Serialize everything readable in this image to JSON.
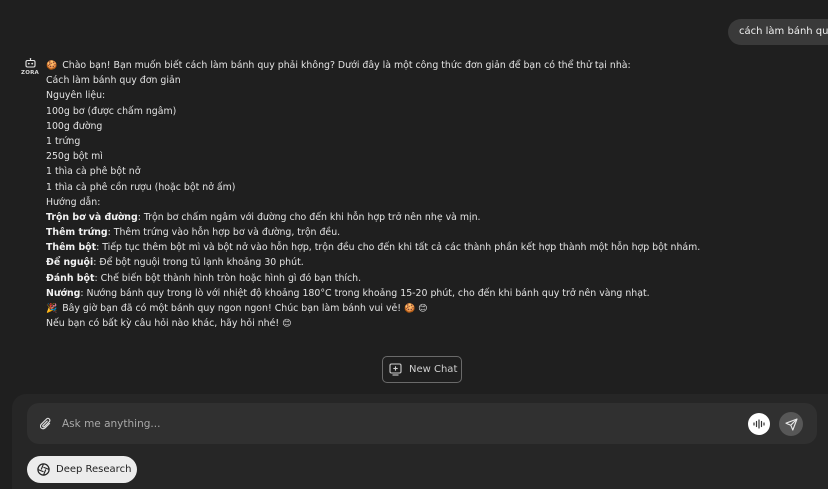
{
  "user_message": "cách làm bánh quy",
  "bot": {
    "name": "ZORA"
  },
  "answer": {
    "intro_emoji": "🍪",
    "intro": "Chào bạn! Bạn muốn biết cách làm bánh quy phải không? Dưới đây là một công thức đơn giản để bạn có thể thử tại nhà:",
    "recipe_title": "Cách làm bánh quy đơn giản",
    "ingredients_heading": "Nguyên liệu:",
    "ingredients": [
      "100g bơ (được chấm ngâm)",
      "100g đường",
      "1 trứng",
      "250g bột mì",
      "1 thìa cà phê bột nở",
      "1 thìa cà phê cồn rượu (hoặc bột nở ấm)"
    ],
    "steps_heading": "Hướng dẫn:",
    "steps": [
      {
        "label": "Trộn bơ và đường",
        "text": ": Trộn bơ chấm ngâm với đường cho đến khi hỗn hợp trở nên nhẹ và mịn."
      },
      {
        "label": "Thêm trứng",
        "text": ": Thêm trứng vào hỗn hợp bơ và đường, trộn đều."
      },
      {
        "label": "Thêm bột",
        "text": ": Tiếp tục thêm bột mì và bột nở vào hỗn hợp, trộn đều cho đến khi tất cả các thành phần kết hợp thành một hỗn hợp bột nhám."
      },
      {
        "label": "Để nguội",
        "text": ": Để bột nguội trong tủ lạnh khoảng 30 phút."
      },
      {
        "label": "Đánh bột",
        "text": ": Chế biến bột thành hình tròn hoặc hình gì đó bạn thích."
      },
      {
        "label": "Nướng",
        "text": ": Nướng bánh quy trong lò với nhiệt độ khoảng 180°C trong khoảng 15-20 phút, cho đến khi bánh quy trở nên vàng nhạt."
      }
    ],
    "closing_emoji": "🎉",
    "closing": "Bây giờ bạn đã có một bánh quy ngon ngon! Chúc bạn làm bánh vui vẻ!",
    "closing_end_emojis": "🍪 😊",
    "followup": "Nếu bạn có bất kỳ câu hỏi nào khác, hãy hỏi nhé!",
    "followup_emoji": "😊"
  },
  "new_chat_label": "New Chat",
  "composer": {
    "placeholder": "Ask me anything..."
  },
  "deep_research_label": "Deep Research"
}
